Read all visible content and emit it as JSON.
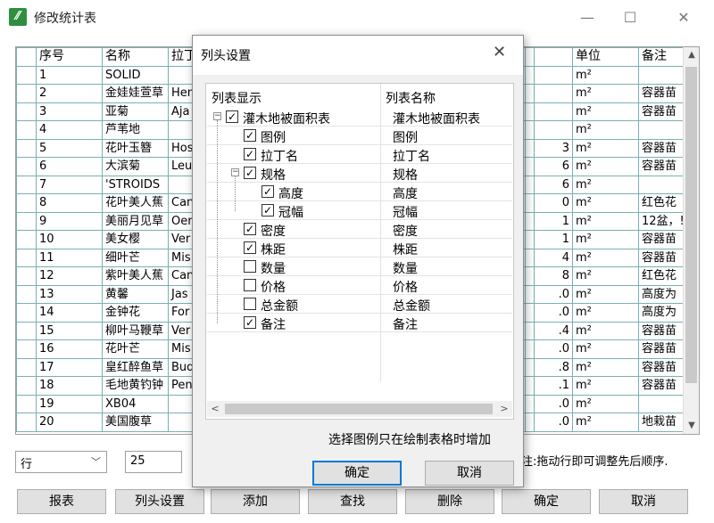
{
  "window": {
    "title": "修改统计表",
    "icon": "app-green-icon"
  },
  "grid": {
    "headers": [
      "",
      "序号",
      "名称",
      "拉丁",
      "",
      "",
      "",
      "",
      "",
      "",
      "",
      "单位",
      "备注"
    ],
    "rows": [
      [
        "1",
        "SOLID",
        "",
        "",
        "m²",
        ""
      ],
      [
        "2",
        "金娃娃萱草",
        "Hem",
        "",
        "m²",
        "容器苗"
      ],
      [
        "3",
        "亚菊",
        "Aja",
        "",
        "m²",
        "容器苗"
      ],
      [
        "4",
        "芦苇地",
        "",
        "",
        "m²",
        ""
      ],
      [
        "5",
        "花叶玉簪",
        "Hos",
        "3",
        "m²",
        "容器苗"
      ],
      [
        "6",
        "大滨菊",
        "Leu",
        "6",
        "m²",
        "容器苗"
      ],
      [
        "7",
        "'STROIDS",
        "",
        "6",
        "m²",
        ""
      ],
      [
        "8",
        "花叶美人蕉",
        "Can",
        "0",
        "m²",
        "红色花"
      ],
      [
        "9",
        "美丽月见草",
        "Oen",
        "1",
        "m²",
        "12盆，!"
      ],
      [
        "10",
        "美女樱",
        "Ver",
        "1",
        "m²",
        "容器苗"
      ],
      [
        "11",
        "细叶芒",
        "Mis",
        "4",
        "m²",
        "容器苗"
      ],
      [
        "12",
        "紫叶美人蕉",
        "Can",
        "8",
        "m²",
        "红色花"
      ],
      [
        "13",
        "黄馨",
        "Jas",
        ".0",
        "m²",
        "高度为"
      ],
      [
        "14",
        "金钟花",
        "For",
        ".0",
        "m²",
        "高度为"
      ],
      [
        "15",
        "柳叶马鞭草",
        "Ver",
        ".4",
        "m²",
        "容器苗"
      ],
      [
        "16",
        "花叶芒",
        "Mis",
        ".0",
        "m²",
        "容器苗"
      ],
      [
        "17",
        "皇红醉鱼草",
        "Bud",
        ".8",
        "m²",
        "容器苗"
      ],
      [
        "18",
        "毛地黄钓钟",
        "Pen",
        ".1",
        "m²",
        "容器苗"
      ],
      [
        "19",
        "XB04",
        "",
        ".0",
        "m²",
        ""
      ],
      [
        "20",
        "美国腹草",
        "",
        ".0",
        "m²",
        "地栽苗"
      ]
    ]
  },
  "controls": {
    "row_select": "行",
    "row_number": "25",
    "hint": "注:拖动行即可调整先后顺序."
  },
  "buttons": {
    "report": "报表",
    "column_settings": "列头设置",
    "add": "添加",
    "find": "查找",
    "delete": "删除",
    "ok": "确定",
    "cancel": "取消"
  },
  "dialog": {
    "title": "列头设置",
    "col_display": "列表显示",
    "col_name": "列表名称",
    "tree": [
      {
        "label": "灌木地被面积表",
        "name": "灌木地被面积表",
        "checked": true,
        "level": 0,
        "expander": "minus"
      },
      {
        "label": "图例",
        "name": "图例",
        "checked": true,
        "level": 1
      },
      {
        "label": "拉丁名",
        "name": "拉丁名",
        "checked": true,
        "level": 1
      },
      {
        "label": "规格",
        "name": "规格",
        "checked": true,
        "level": 1,
        "expander": "minus"
      },
      {
        "label": "高度",
        "name": "高度",
        "checked": true,
        "level": 2
      },
      {
        "label": "冠幅",
        "name": "冠幅",
        "checked": true,
        "level": 2
      },
      {
        "label": "密度",
        "name": "密度",
        "checked": true,
        "level": 1
      },
      {
        "label": "株距",
        "name": "株距",
        "checked": true,
        "level": 1
      },
      {
        "label": "数量",
        "name": "数量",
        "checked": false,
        "level": 1
      },
      {
        "label": "价格",
        "name": "价格",
        "checked": false,
        "level": 1
      },
      {
        "label": "总金额",
        "name": "总金额",
        "checked": false,
        "level": 1
      },
      {
        "label": "备注",
        "name": "备注",
        "checked": true,
        "level": 1
      }
    ],
    "note": "选择图例只在绘制表格时增加",
    "ok": "确定",
    "cancel": "取消"
  }
}
